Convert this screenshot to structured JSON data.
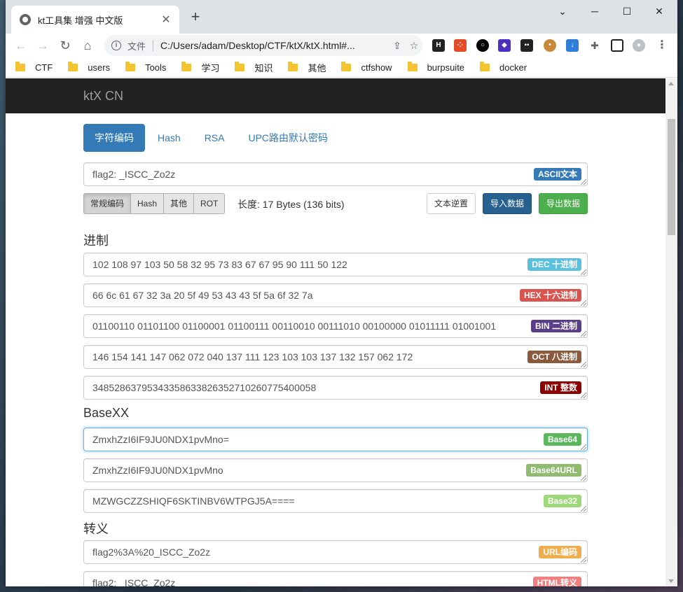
{
  "browser": {
    "tab_title": "kt工具集 增强 中文版",
    "tab_close": "✕",
    "new_tab": "+",
    "omnibox_label": "文件",
    "url": "C:/Users/adam/Desktop/CTF/ktX/ktX.html#...",
    "bookmarks": [
      "CTF",
      "users",
      "Tools",
      "学习",
      "知识",
      "其他",
      "ctfshow",
      "burpsuite",
      "docker"
    ]
  },
  "page": {
    "brand": "ktX CN",
    "tabs": [
      "字符编码",
      "Hash",
      "RSA",
      "UPC路由默认密码"
    ],
    "input": {
      "value": "flag2: _ISCC_Zo2z",
      "badge": "ASCII文本"
    },
    "encode_groups": [
      "常规编码",
      "Hash",
      "其他",
      "ROT"
    ],
    "length_text": "长度: 17 Bytes (136 bits)",
    "buttons": {
      "reverse": "文本逆置",
      "import": "导入数据",
      "export": "导出数据"
    },
    "sections": {
      "radix": "进制",
      "basexx": "BaseXX",
      "escape": "转义"
    },
    "radix_fields": [
      {
        "value": "102 108 97 103 50 58 32 95 73 83 67 67 95 90 111 50 122",
        "badge": "DEC 十进制",
        "color": "#5bc0de"
      },
      {
        "value": "66 6c 61 67 32 3a 20 5f 49 53 43 43 5f 5a 6f 32 7a",
        "badge": "HEX 十六进制",
        "color": "#d9534f"
      },
      {
        "value": "01100110 01101100 01100001 01100111 00110010 00111010 00100000 01011111 01001001 01010011 01000011 01000011 01011111 01011010 01101111 00110010 01111010",
        "badge": "BIN 二进制",
        "color": "#5b3e8a"
      },
      {
        "value": "146 154 141 147 062 072 040 137 111 123 103 103 137 132 157 062 172",
        "badge": "OCT 八进制",
        "color": "#8b5a3c"
      },
      {
        "value": "34852863795343358633826352710260775400058",
        "badge": "INT 整数",
        "color": "#8b0000"
      }
    ],
    "base_fields": [
      {
        "value": "ZmxhZzI6IF9JU0NDX1pvMno=",
        "badge": "Base64",
        "color": "#5cb85c"
      },
      {
        "value": "ZmxhZzI6IF9JU0NDX1pvMno",
        "badge": "Base64URL",
        "color": "#8fbc6f"
      },
      {
        "value": "MZWGCZZSHIQF6SKTINBV6WTPGJ5A====",
        "badge": "Base32",
        "color": "#9ed87a"
      }
    ],
    "escape_fields": [
      {
        "value": "flag2%3A%20_ISCC_Zo2z",
        "badge": "URL编码",
        "color": "#f0ad4e"
      },
      {
        "value": "flag2: _ISCC_Zo2z",
        "badge": "HTML转义",
        "color": "#f08080"
      }
    ]
  }
}
